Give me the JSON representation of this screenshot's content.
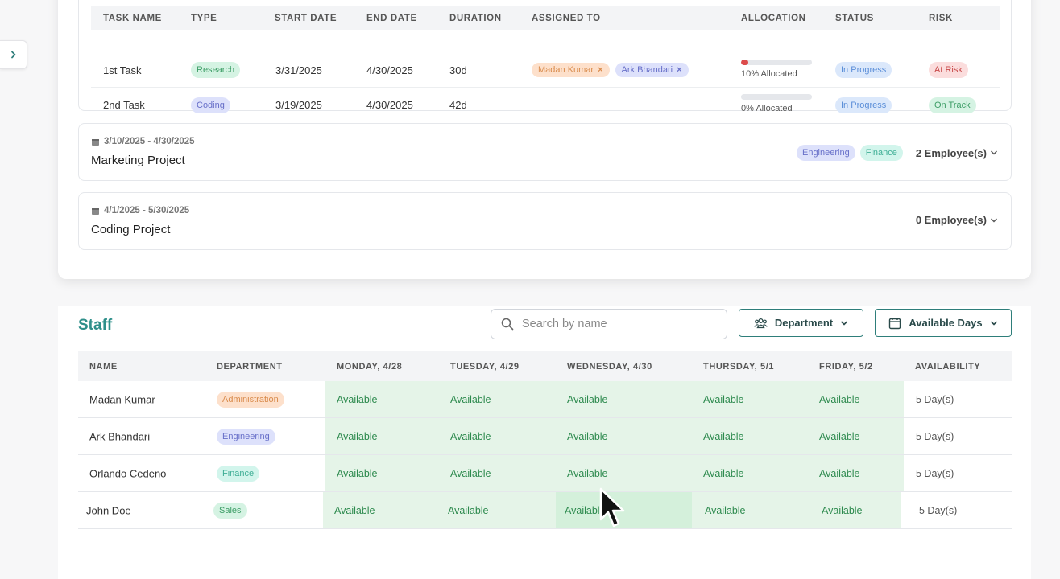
{
  "sidebar_toggle_icon": "chevron-right-icon",
  "tasks": {
    "columns": [
      "TASK NAME",
      "TYPE",
      "START DATE",
      "END DATE",
      "DURATION",
      "ASSIGNED TO",
      "ALLOCATION",
      "STATUS",
      "RISK"
    ],
    "rows": [
      {
        "name": "1st Task",
        "type": "Research",
        "start": "3/31/2025",
        "end": "4/30/2025",
        "duration": "30d",
        "assigned": [
          "Madan Kumar",
          "Ark Bhandari"
        ],
        "allocation_pct": 10,
        "allocation_text": "10% Allocated",
        "status": "In Progress",
        "risk": "At Risk"
      },
      {
        "name": "2nd Task",
        "type": "Coding",
        "start": "3/19/2025",
        "end": "4/30/2025",
        "duration": "42d",
        "assigned": [],
        "allocation_pct": 0,
        "allocation_text": "0% Allocated",
        "status": "In Progress",
        "risk": "On Track"
      }
    ]
  },
  "projects": [
    {
      "dates": "3/10/2025 - 4/30/2025",
      "name": "Marketing Project",
      "departments": [
        "Engineering",
        "Finance"
      ],
      "employees": "2 Employee(s)"
    },
    {
      "dates": "4/1/2025 - 5/30/2025",
      "name": "Coding Project",
      "departments": [],
      "employees": "0 Employee(s)"
    }
  ],
  "staff": {
    "title": "Staff",
    "search_placeholder": "Search by name",
    "department_button": "Department",
    "available_days_button": "Available Days",
    "columns": [
      "NAME",
      "DEPARTMENT",
      "MONDAY, 4/28",
      "TUESDAY, 4/29",
      "WEDNESDAY, 4/30",
      "THURSDAY, 5/1",
      "FRIDAY, 5/2",
      "AVAILABILITY"
    ],
    "rows": [
      {
        "name": "Madan Kumar",
        "department": "Administration",
        "days": [
          "Available",
          "Available",
          "Available",
          "Available",
          "Available"
        ],
        "availability": "5 Day(s)"
      },
      {
        "name": "Ark Bhandari",
        "department": "Engineering",
        "days": [
          "Available",
          "Available",
          "Available",
          "Available",
          "Available"
        ],
        "availability": "5 Day(s)"
      },
      {
        "name": "Orlando Cedeno",
        "department": "Finance",
        "days": [
          "Available",
          "Available",
          "Available",
          "Available",
          "Available"
        ],
        "availability": "5 Day(s)"
      },
      {
        "name": "John Doe",
        "department": "Sales",
        "days": [
          "Available",
          "Available",
          "Available",
          "Available",
          "Available"
        ],
        "availability": "5 Day(s)"
      }
    ]
  },
  "colors": {
    "accent": "#2e8f8a",
    "available_bg": "#e5f4e8",
    "available_text": "#2d8a4e",
    "allocation_fill": "#dc4b4b"
  }
}
